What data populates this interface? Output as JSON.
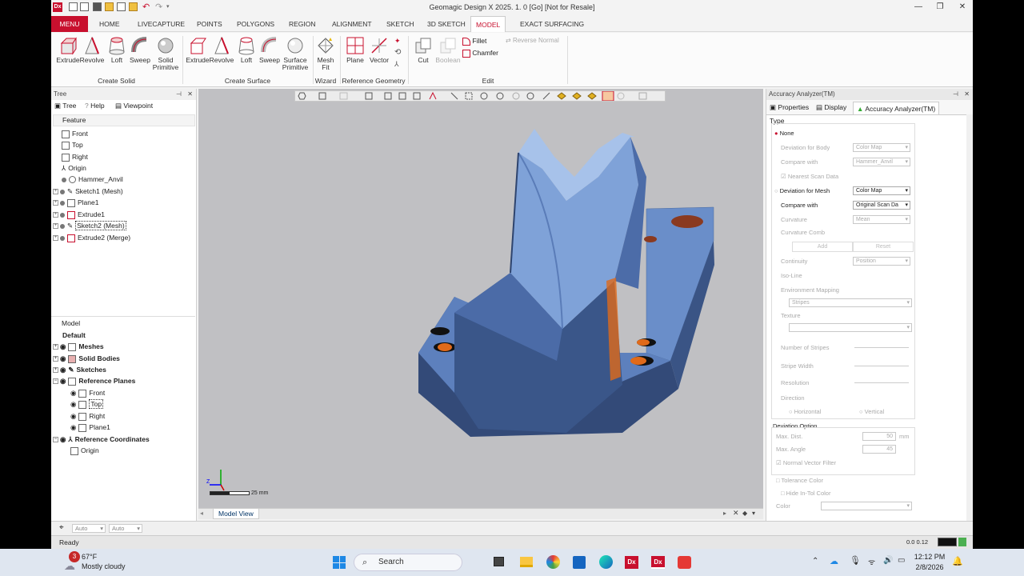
{
  "window": {
    "title": "Geomagic Design X 2025. 1. 0 [Go] [Not for Resale]",
    "app_icon": "Dx"
  },
  "ribbon_tabs": [
    "MENU",
    "HOME",
    "LIVECAPTURE",
    "POINTS",
    "POLYGONS",
    "REGION",
    "ALIGNMENT",
    "SKETCH",
    "3D SKETCH",
    "MODEL",
    "EXACT SURFACING"
  ],
  "ribbon": {
    "create_solid": {
      "label": "Create Solid",
      "buttons": [
        "Extrude",
        "Revolve",
        "Loft",
        "Sweep",
        "Solid\nPrimitive"
      ]
    },
    "create_surface": {
      "label": "Create Surface",
      "buttons": [
        "Extrude",
        "Revolve",
        "Loft",
        "Sweep",
        "Surface\nPrimitive"
      ]
    },
    "wizard": {
      "label": "Wizard",
      "buttons": [
        "Mesh\nFit"
      ]
    },
    "reference_geometry": {
      "label": "Reference Geometry",
      "buttons": [
        "Plane",
        "Vector"
      ]
    },
    "edit": {
      "label": "Edit",
      "buttons": [
        "Cut",
        "Boolean"
      ],
      "small": [
        "Fillet",
        "Chamfer"
      ],
      "reverse_normal": "Reverse Normal"
    }
  },
  "left_panel": {
    "title": "Tree",
    "tabs": [
      "Tree",
      "Help",
      "Viewpoint"
    ],
    "feature_header": "Feature",
    "features": [
      "Front",
      "Top",
      "Right",
      "Origin",
      "Hammer_Anvil",
      "Sketch1 (Mesh)",
      "Plane1",
      "Extrude1",
      "Sketch2 (Mesh)",
      "Extrude2 (Merge)"
    ],
    "model_header": "Model",
    "model_items": [
      "Default",
      "Meshes",
      "Solid Bodies",
      "Sketches",
      "Reference Planes",
      "Front",
      "Top",
      "Right",
      "Plane1",
      "Reference Coordinates",
      "Origin"
    ]
  },
  "viewport": {
    "scale_label": "25 mm",
    "tab": "Model View"
  },
  "right_panel": {
    "title": "Accuracy Analyzer(TM)",
    "tabs": [
      "Properties",
      "Display",
      "Accuracy Analyzer(TM)"
    ],
    "type_label": "Type",
    "options": [
      {
        "label": "None",
        "value": ""
      },
      {
        "label": "Deviation for Body",
        "value": "Color Map"
      },
      {
        "label": "Compare with",
        "value": "Hammer_Anvil"
      },
      {
        "label": "Nearest Scan Data",
        "value": ""
      },
      {
        "label": "Deviation for Mesh",
        "value": "Color Map"
      },
      {
        "label": "Compare with",
        "value": "Original Scan Da"
      },
      {
        "label": "Curvature",
        "value": "Mean"
      },
      {
        "label": "Curvature Comb",
        "value": ""
      }
    ],
    "add": "Add",
    "reset": "Reset",
    "more": [
      "Continuity",
      "Iso-Line",
      "Environment Mapping"
    ],
    "continuity_value": "Position",
    "stripes": "Stripes",
    "texture": "Texture",
    "sliders": [
      "Number of Stripes",
      "Stripe Width",
      "Resolution"
    ],
    "direction": "Direction",
    "horizontal": "Horizontal",
    "vertical": "Vertical",
    "deviation_option": "Deviation Option",
    "max_dist": "Max. Dist.",
    "max_dist_val": "50",
    "mm": "mm",
    "max_angle": "Max. Angle",
    "max_angle_val": "45",
    "normal_vector": "Normal Vector Filter",
    "tolerance_color": "Tolerance Color",
    "hide_in_tol": "Hide In-Tol Color",
    "color": "Color"
  },
  "status": {
    "text": "Ready",
    "coords": "0.0 0.12"
  },
  "taskbar": {
    "temp": "67°F",
    "weather": "Mostly cloudy",
    "badge": "3",
    "search": "Search",
    "time": "12:12 PM",
    "date": "2/8/2026"
  },
  "bottom_tools": [
    "Auto",
    "Auto"
  ],
  "colors": {
    "accent": "#c8102e",
    "model": "#6b8fc7",
    "orange": "#e06a1a"
  }
}
